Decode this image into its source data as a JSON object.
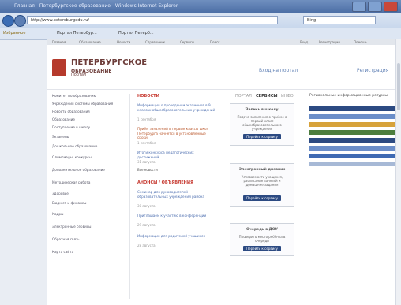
{
  "browser": {
    "title": "Главная - Петербургское образование - Windows Internet Explorer",
    "address": "http://www.petersburgedu.ru/",
    "search_placeholder": "Bing",
    "favorites_label": "Избранное",
    "favorites": [
      "Портал Петербур...",
      "Портал Петерб..."
    ]
  },
  "site": {
    "top_menu": [
      "Главная",
      "Образование",
      "Новости",
      "Справочник",
      "Сервисы",
      "Поиск"
    ],
    "top_links": [
      "Вход",
      "Регистрация",
      "Помощь"
    ],
    "name_line1": "ПЕТЕРБУРГСКОЕ",
    "name_line2": "ОБРАЗОВАНИЕ",
    "name_sub": "Портал",
    "header_links": [
      "Вход на портал",
      "Регистрация"
    ]
  },
  "sidebar": {
    "items": [
      "Комитет по образованию",
      "Учреждения системы образования",
      "Новости образования",
      "Образование",
      "Поступление в школу",
      "Экзамены",
      "Дошкольное образование",
      "Олимпиады, конкурсы",
      "Дополнительное образование",
      "Методическая работа",
      "Здоровье",
      "Бюджет и финансы",
      "Кадры",
      "Электронные сервисы",
      "Обратная связь",
      "Карта сайта"
    ]
  },
  "news": {
    "title": "НОВОСТИ",
    "items": [
      {
        "text": "Информация о проведении экзаменов в 9 классах общеобразовательных учреждений",
        "date": "1 сентября"
      },
      {
        "text": "Приём заявлений в первые классы школ Петербурга начнётся в установленные сроки",
        "date": "1 сентября"
      },
      {
        "text": "Итоги конкурса педагогических достижений",
        "date": "31 августа"
      }
    ],
    "all_link": "Все новости"
  },
  "announcements": {
    "title": "АНОНСЫ / ОБЪЯВЛЕНИЯ",
    "items": [
      {
        "text": "Семинар для руководителей образовательных учреждений района",
        "date": "30 августа"
      },
      {
        "text": "Приглашаем к участию в конференции",
        "date": "29 августа"
      },
      {
        "text": "Информация для родителей учащихся",
        "date": "28 августа"
      }
    ]
  },
  "services": {
    "tabs": [
      "ПОРТАЛ",
      "СЕРВИСЫ",
      "ИНФО"
    ],
    "boxes": [
      {
        "title": "Запись в школу",
        "text": "Подача заявления о приёме в первый класс общеобразовательного учреждения",
        "button": "Перейти к сервису"
      },
      {
        "title": "Электронный дневник",
        "text": "Успеваемость учащихся, расписание занятий и домашние задания",
        "button": "Перейти к сервису"
      },
      {
        "title": "Очередь в ДОУ",
        "text": "Проверить место ребёнка в очереди",
        "button": "Перейти к сервису"
      }
    ]
  },
  "right_column": {
    "title": "Региональные информационные ресурсы",
    "banners": [
      "#2c4a82",
      "#6b8ec9",
      "#d7a23a",
      "#4c7d3e",
      "#2c4a82",
      "#6b8ec9",
      "#3f6ab3",
      "#a7b9d6"
    ]
  }
}
